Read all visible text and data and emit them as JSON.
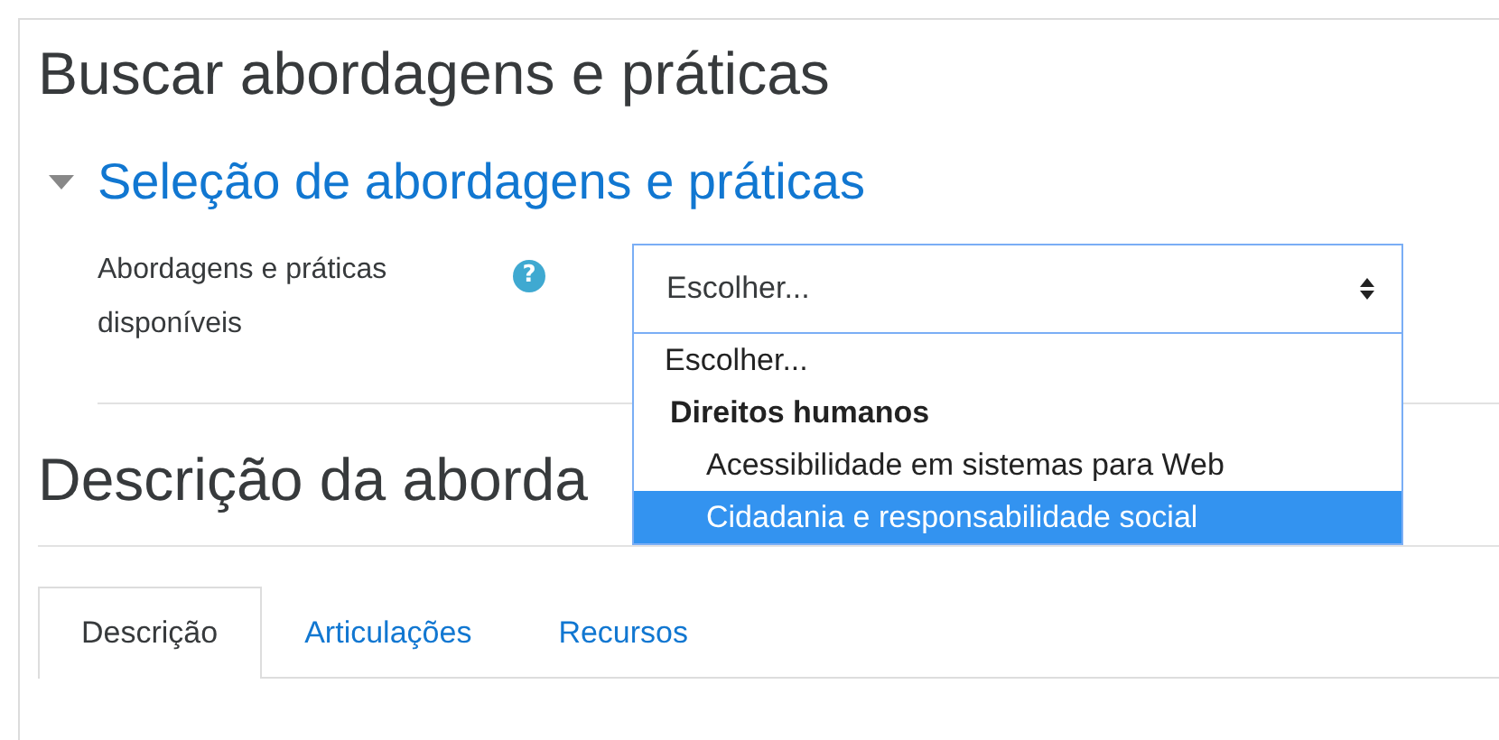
{
  "page_title": "Buscar abordagens e práticas",
  "section": {
    "title": "Seleção de abordagens e práticas",
    "expanded": true,
    "field": {
      "label": "Abordagens e práticas disponíveis",
      "help": "?",
      "value": "Escolher...",
      "expanded": true,
      "options": [
        {
          "kind": "option",
          "label": "Escolher...",
          "highlighted": false
        },
        {
          "kind": "group",
          "label": "Direitos humanos",
          "children": [
            {
              "kind": "option",
              "label": "Acessibilidade em sistemas para Web",
              "highlighted": false
            },
            {
              "kind": "option",
              "label": "Cidadania e responsabilidade social",
              "highlighted": true
            }
          ]
        }
      ]
    }
  },
  "description_title": "Descrição da aborda",
  "tabs": [
    {
      "label": "Descrição",
      "selected": true
    },
    {
      "label": "Articulações",
      "selected": false
    },
    {
      "label": "Recursos",
      "selected": false
    }
  ]
}
